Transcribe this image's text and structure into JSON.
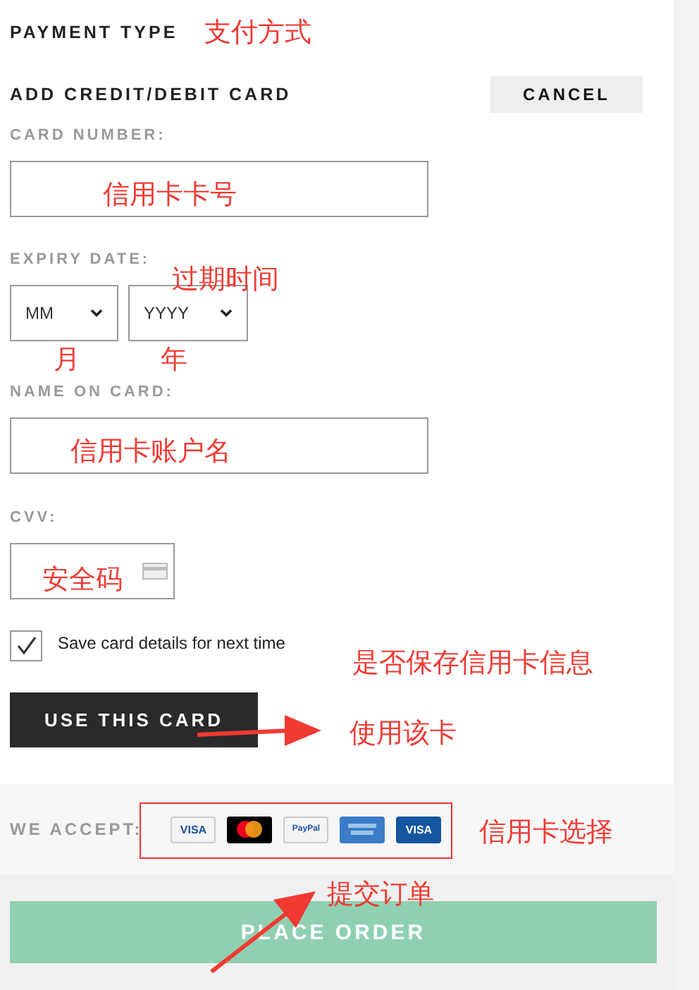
{
  "payment_type": {
    "title": "PAYMENT TYPE"
  },
  "card_form": {
    "title": "ADD CREDIT/DEBIT CARD",
    "cancel": "CANCEL",
    "card_number": {
      "label": "CARD NUMBER:"
    },
    "expiry": {
      "label": "EXPIRY DATE:",
      "month": "MM",
      "year": "YYYY"
    },
    "name_on_card": {
      "label": "NAME ON CARD:"
    },
    "cvv": {
      "label": "CVV:"
    },
    "save_details": {
      "label": "Save card details for next time",
      "checked": true
    },
    "submit": "USE THIS CARD"
  },
  "accepted_cards": {
    "label": "WE ACCEPT:",
    "cards": [
      {
        "kind": "visa",
        "text": "VISA"
      },
      {
        "kind": "mastercard"
      },
      {
        "kind": "paypal",
        "text": "PayPal"
      },
      {
        "kind": "amex"
      },
      {
        "kind": "visa-electron",
        "text": "VISA"
      }
    ]
  },
  "place_order": {
    "label": "PLACE ORDER",
    "disabled": true
  },
  "annotations": [
    {
      "kind": "note",
      "text": "支付方式"
    },
    {
      "kind": "note",
      "text": "信用卡卡号"
    },
    {
      "kind": "note",
      "text": "过期时间"
    },
    {
      "kind": "note",
      "text": "月"
    },
    {
      "kind": "note",
      "text": "年"
    },
    {
      "kind": "note",
      "text": "信用卡账户名"
    },
    {
      "kind": "note",
      "text": "安全码"
    },
    {
      "kind": "note",
      "text": "是否保存信用卡信息"
    },
    {
      "kind": "note",
      "text": "使用该卡"
    },
    {
      "kind": "note",
      "text": "信用卡选择"
    },
    {
      "kind": "note",
      "text": "提交订单"
    },
    {
      "kind": "box"
    },
    {
      "kind": "arrow"
    },
    {
      "kind": "arrow"
    }
  ]
}
